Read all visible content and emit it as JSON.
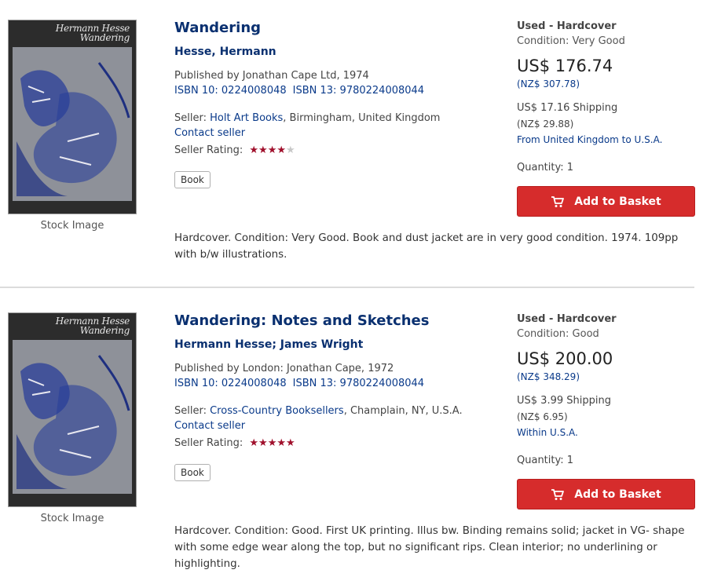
{
  "listings": [
    {
      "cover": {
        "line1": "Hermann Hesse",
        "line2": "Wandering"
      },
      "stock_label": "Stock Image",
      "title": "Wandering",
      "author": "Hesse, Hermann",
      "published": "Published by Jonathan Cape Ltd, 1974",
      "isbn10": "ISBN 10: 0224008048",
      "isbn13": "ISBN 13: 9780224008044",
      "seller_prefix": "Seller: ",
      "seller_name": "Holt Art Books",
      "seller_location": ", Birmingham, United Kingdom",
      "contact": "Contact seller",
      "rating_label": "Seller Rating:",
      "rating": 4,
      "stars_on": "★★★★",
      "stars_off": "★",
      "badge": "Book",
      "description": "Hardcover. Condition: Very Good. Book and dust jacket are in very good condition. 1974. 109pp with b/w illustrations.",
      "binding": "Used - Hardcover",
      "condition": "Condition: Very Good",
      "price": "US$ 176.74",
      "price_nz": "(NZ$ 307.78)",
      "shipping": "US$ 17.16 Shipping",
      "shipping_nz": "(NZ$ 29.88)",
      "route": "From United Kingdom to U.S.A.",
      "quantity": "Quantity: 1",
      "add_label": "Add to Basket"
    },
    {
      "cover": {
        "line1": "Hermann Hesse",
        "line2": "Wandering"
      },
      "stock_label": "Stock Image",
      "title": "Wandering: Notes and Sketches",
      "author": "Hermann Hesse; James Wright",
      "published": "Published by London: Jonathan Cape, 1972",
      "isbn10": "ISBN 10: 0224008048",
      "isbn13": "ISBN 13: 9780224008044",
      "seller_prefix": "Seller: ",
      "seller_name": "Cross-Country Booksellers",
      "seller_location": ", Champlain, NY, U.S.A.",
      "contact": "Contact seller",
      "rating_label": "Seller Rating:",
      "rating": 5,
      "stars_on": "★★★★★",
      "stars_off": "",
      "badge": "Book",
      "description": "Hardcover. Condition: Good. First UK printing. Illus bw. Binding remains solid; jacket in VG- shape with some edge wear along the top, but no significant rips. Clean interior; no underlining or highlighting.",
      "binding": "Used - Hardcover",
      "condition": "Condition: Good",
      "price": "US$ 200.00",
      "price_nz": "(NZ$ 348.29)",
      "shipping": "US$ 3.99 Shipping",
      "shipping_nz": "(NZ$ 6.95)",
      "route": "Within U.S.A.",
      "quantity": "Quantity: 1",
      "add_label": "Add to Basket"
    }
  ],
  "colors": {
    "link": "#0a3070",
    "button": "#d62c2c",
    "star": "#a0102c"
  },
  "icons": {
    "basket": "cart-icon",
    "star": "star-icon"
  }
}
